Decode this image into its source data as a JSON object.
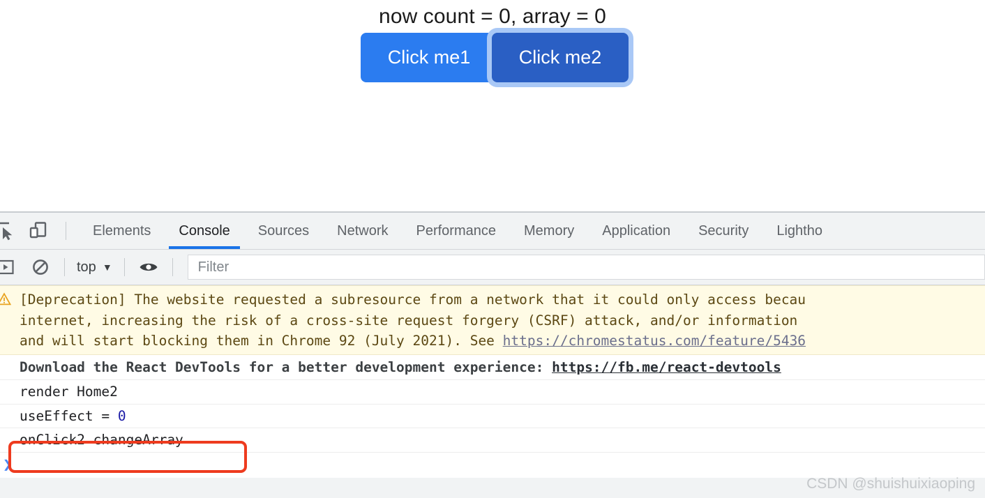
{
  "page": {
    "heading": "now count = 0, array = 0",
    "buttons": [
      {
        "name": "click-me1",
        "label": "Click me1",
        "color": "#2b7cf0"
      },
      {
        "name": "click-me2",
        "label": "Click me2",
        "color": "#2a5fc4",
        "focus_ring": "#a9c8f6"
      }
    ]
  },
  "devtools": {
    "icons": {
      "inspect": "inspect-element-icon",
      "device": "device-toolbar-icon",
      "sidebar": "console-sidebar-icon",
      "clear": "clear-console-icon",
      "eye": "live-expression-eye-icon"
    },
    "tabs": [
      {
        "label": "Elements",
        "active": false
      },
      {
        "label": "Console",
        "active": true
      },
      {
        "label": "Sources",
        "active": false
      },
      {
        "label": "Network",
        "active": false
      },
      {
        "label": "Performance",
        "active": false
      },
      {
        "label": "Memory",
        "active": false
      },
      {
        "label": "Application",
        "active": false
      },
      {
        "label": "Security",
        "active": false
      },
      {
        "label": "Lightho",
        "active": false
      }
    ],
    "active_tab_underline_color": "#1a73e8",
    "toolbar": {
      "context": "top",
      "context_caret": "▼",
      "filter_placeholder": "Filter",
      "filter_value": ""
    },
    "messages": [
      {
        "type": "warning",
        "lines": [
          "[Deprecation] The website requested a subresource from a network that it could only access becau",
          "internet, increasing the risk of a cross-site request forgery (CSRF) attack, and/or information ",
          "and will start blocking them in Chrome 92 (July 2021). See "
        ],
        "link": "https://chromestatus.com/feature/5436",
        "background": "#fffbe5",
        "text_color": "#5c4813"
      },
      {
        "type": "log-bold",
        "text": "Download the React DevTools for a better development experience: ",
        "link": "https://fb.me/react-devtools"
      },
      {
        "type": "log",
        "text": "render Home2"
      },
      {
        "type": "log",
        "text_before": "useEffect = ",
        "value": "0",
        "value_color": "#1a1aa6"
      },
      {
        "type": "log",
        "text": "onClick2 changeArray",
        "highlighted": true
      }
    ],
    "highlight_color": "#ee3b1f",
    "prompt_chevron": "❯"
  },
  "watermark": "CSDN @shuishuixiaoping"
}
